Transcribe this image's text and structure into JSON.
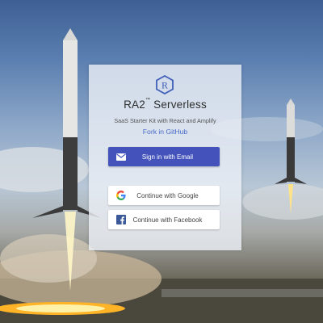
{
  "app": {
    "title": "RA2",
    "trademark": "™",
    "title_suffix": " Serverless",
    "subtitle": "SaaS Starter Kit with React and Amplify",
    "fork_link": "Fork in GitHub"
  },
  "buttons": {
    "email_label": "Sign in with Email",
    "google_label": "Continue with Google",
    "facebook_label": "Continue with Facebook"
  },
  "icons": {
    "logo": "ra2-logo-icon",
    "email": "envelope-icon",
    "google": "google-icon",
    "facebook": "facebook-icon"
  },
  "colors": {
    "primary": "#4353bb",
    "link": "#4a6ac7",
    "facebook": "#3b5998"
  }
}
